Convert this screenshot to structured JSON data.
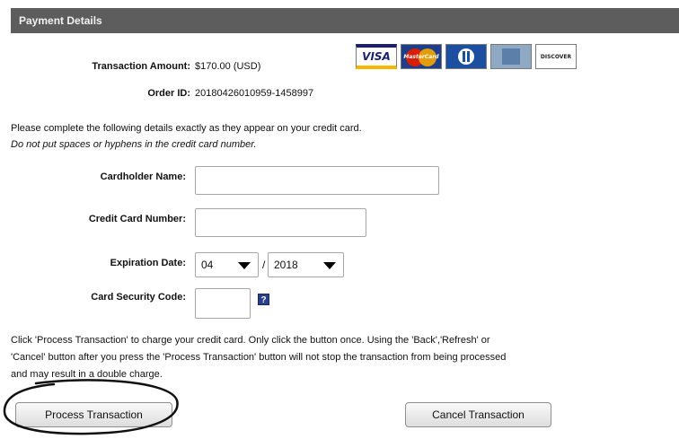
{
  "header": {
    "title": "Payment Details"
  },
  "summary": {
    "amount_label": "Transaction Amount:",
    "amount_value": "$170.00 (USD)",
    "order_label": "Order ID:",
    "order_value": "20180426010959-1458997"
  },
  "card_logos": [
    {
      "name": "visa-logo",
      "text": "VISA"
    },
    {
      "name": "mastercard-logo",
      "text": "MasterCard"
    },
    {
      "name": "diners-club-logo",
      "text": ""
    },
    {
      "name": "american-express-logo",
      "text": ""
    },
    {
      "name": "discover-logo",
      "text": "DISCOVER"
    }
  ],
  "instructions": {
    "line1": "Please complete the following details exactly as they appear on your credit card.",
    "line2": "Do not put spaces or hyphens in the credit card number."
  },
  "form": {
    "cardholder_label": "Cardholder Name:",
    "cardholder_value": "",
    "card_number_label": "Credit Card Number:",
    "card_number_value": "",
    "expiration_label": "Expiration Date:",
    "expiration_month": "04",
    "expiration_separator": "/",
    "expiration_year": "2018",
    "security_label": "Card Security Code:",
    "security_value": "",
    "help_icon": "?"
  },
  "notice": {
    "line1": "Click 'Process Transaction' to charge your credit card. Only click the button once. Using the 'Back','Refresh' or",
    "line2": "'Cancel' button after you press the 'Process Transaction' button will not stop the transaction from being processed",
    "line3": "and may result in a double charge."
  },
  "buttons": {
    "process": "Process Transaction",
    "cancel": "Cancel Transaction"
  },
  "colors": {
    "header_bg": "#5d5d5d",
    "annotation_ink": "#111111"
  }
}
